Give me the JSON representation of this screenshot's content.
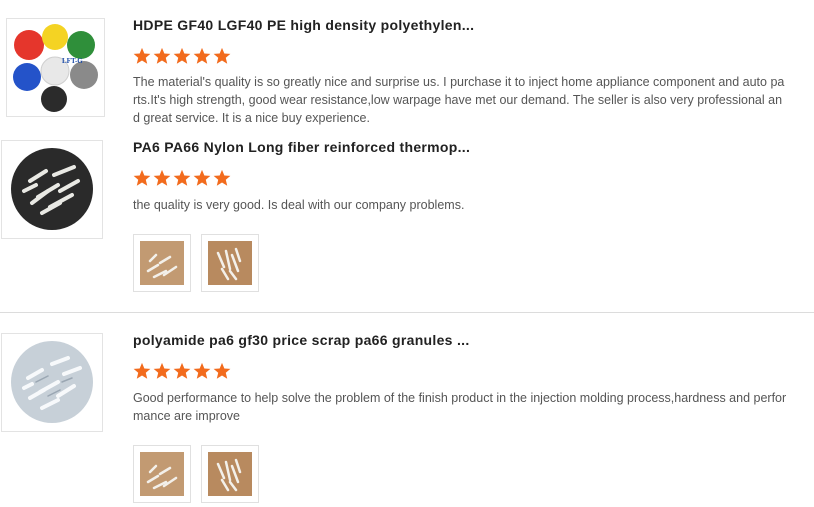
{
  "colors": {
    "star": "#f26b1d",
    "divider": "#dcdcdc"
  },
  "reviews": [
    {
      "title": "HDPE GF40 LGF40 PE high density polyethylen...",
      "rating": 5,
      "text": "The material's quality is so greatly nice and surprise us. I purchase it to inject home appliance component and auto parts.It's high strength, good wear resistance,low warpage have met our demand. The seller is also very professional and great service. It is a nice buy experience.",
      "logo_text": "LFT-G"
    },
    {
      "title": "PA6 PA66 Nylon Long fiber reinforced thermop...",
      "rating": 5,
      "text": "the quality is very good. Is deal with our company problems.",
      "photos": [
        "review-photo-1",
        "review-photo-2"
      ]
    },
    {
      "title": "polyamide pa6 gf30 price scrap pa66 granules ...",
      "rating": 5,
      "text": "Good performance to help solve the problem of the finish product in the injection molding process,hardness and performance are improve",
      "photos": [
        "review-photo-1",
        "review-photo-2"
      ]
    }
  ]
}
